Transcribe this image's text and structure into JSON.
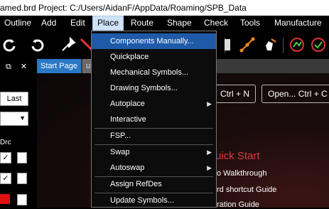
{
  "title_bar": {
    "text": "amed.brd  Project: C:/Users/AidanF/AppData/Roaming/SPB_Data"
  },
  "menu_bar": {
    "items": [
      "Outline",
      "Add",
      "Edit",
      "Place",
      "Route",
      "Shape",
      "Check",
      "Tools",
      "Manufacture"
    ]
  },
  "tabs": {
    "active": "Start Page",
    "inactive": "ur"
  },
  "left_panel": {
    "last_label": "Last",
    "drc_label": "Drc"
  },
  "start_page": {
    "buttons": [
      "Ctrl + N",
      "Open... Ctrl + C"
    ],
    "quick_start_title": "uick Start",
    "links": [
      "o Walkthrough",
      "rd shortcut Guide",
      "ration Guide"
    ]
  },
  "place_menu": {
    "items": [
      {
        "label": "Components Manually...",
        "submenu": false,
        "highlighted": true
      },
      {
        "label": "Quickplace",
        "submenu": false
      },
      {
        "label": "Mechanical Symbols...",
        "submenu": false
      },
      {
        "label": "Drawing Symbols...",
        "submenu": false
      },
      {
        "label": "Autoplace",
        "submenu": true
      },
      {
        "label": "Interactive",
        "submenu": false
      },
      {
        "label": "FSP...",
        "submenu": false
      },
      {
        "label": "Swap",
        "submenu": true
      },
      {
        "label": "Autoswap",
        "submenu": true
      },
      {
        "label": "Assign RefDes",
        "submenu": false
      },
      {
        "label": "Update Symbols...",
        "submenu": false
      }
    ]
  },
  "colors": {
    "highlight": "#1e5aa8",
    "active_tab": "#2b78c5",
    "quick_start": "#d83b3b"
  },
  "icons": [
    "undo-icon",
    "redo-icon",
    "pin-icon",
    "pin-off-icon",
    "route-icon",
    "hand-icon",
    "drc-icon"
  ]
}
